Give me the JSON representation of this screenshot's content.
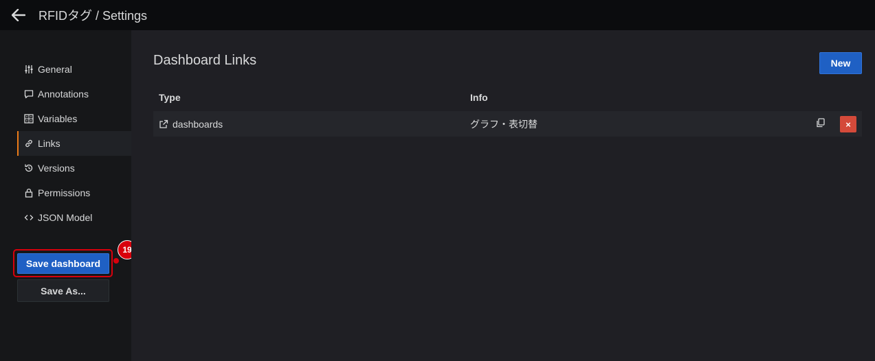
{
  "topbar": {
    "title": "RFIDタグ / Settings",
    "back_icon": "arrow-left-icon"
  },
  "sidebar": {
    "items": [
      {
        "label": "General",
        "icon": "sliders-icon"
      },
      {
        "label": "Annotations",
        "icon": "comment-icon"
      },
      {
        "label": "Variables",
        "icon": "calculator-icon"
      },
      {
        "label": "Links",
        "icon": "link-icon",
        "active": true
      },
      {
        "label": "Versions",
        "icon": "history-icon"
      },
      {
        "label": "Permissions",
        "icon": "lock-icon"
      },
      {
        "label": "JSON Model",
        "icon": "code-brackets-icon"
      }
    ],
    "save_label": "Save dashboard",
    "save_as_label": "Save As...",
    "step_badge": "19"
  },
  "main": {
    "heading": "Dashboard Links",
    "new_label": "New",
    "columns": [
      "Type",
      "Info"
    ],
    "rows": [
      {
        "type": "dashboards",
        "info": "グラフ・表切替"
      }
    ],
    "delete_label": "×"
  },
  "colors": {
    "accent_orange": "#eb7b18",
    "primary_blue": "#1f60c4",
    "danger_red": "#d44a3a",
    "highlight_red": "#d8000c"
  }
}
